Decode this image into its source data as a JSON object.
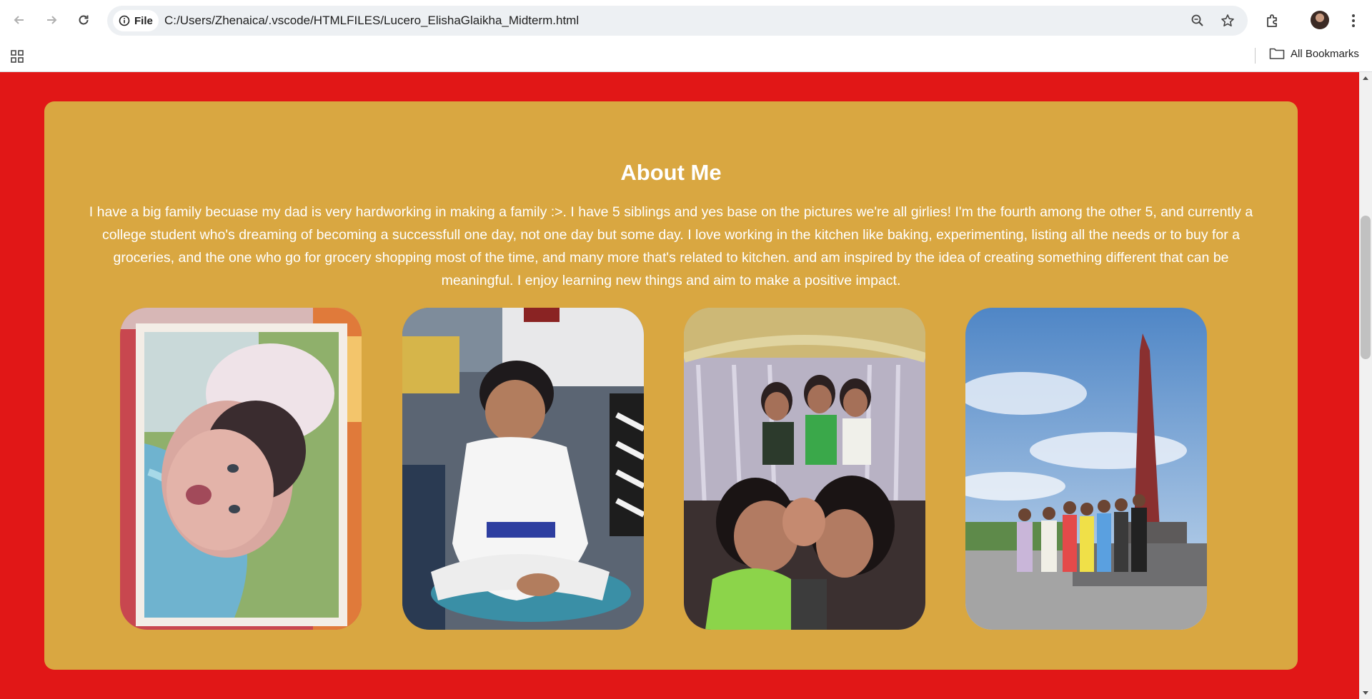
{
  "browser": {
    "chip_label": "File",
    "url": "C:/Users/Zhenaica/.vscode/HTMLFILES/Lucero_ElishaGlaikha_Midterm.html",
    "icons": [
      "back-icon",
      "forward-icon",
      "reload-icon",
      "info-icon",
      "zoom-icon",
      "star-icon",
      "extensions-icon",
      "menu-icon"
    ]
  },
  "bookmarks": {
    "all_bookmarks_label": "All Bookmarks",
    "icons": [
      "apps-grid-icon",
      "folder-icon"
    ]
  },
  "colors": {
    "page_background": "#e11717",
    "card_background": "#d9a741",
    "text": "#ffffff"
  },
  "about": {
    "title": "About Me",
    "text": "I have a big family becuase my dad is very hardworking in making a family :>. I have 5 siblings and yes base on the pictures we're all girlies! I'm the fourth among the other 5, and currently a college student who's dreaming of becoming a successfull one day, not one day but some day. I love working in the kitchen like baking, experimenting, listing all the needs or to buy for a groceries, and the one who go for grocery shopping most of the time, and many more that's related to kitchen. and am inspired by the idea of creating something different that can be meaningful. I enjoy learning new things and aim to make a positive impact.",
    "photos": [
      "baby-photo",
      "karate-photo",
      "sisters-photo",
      "monument-photo"
    ]
  }
}
